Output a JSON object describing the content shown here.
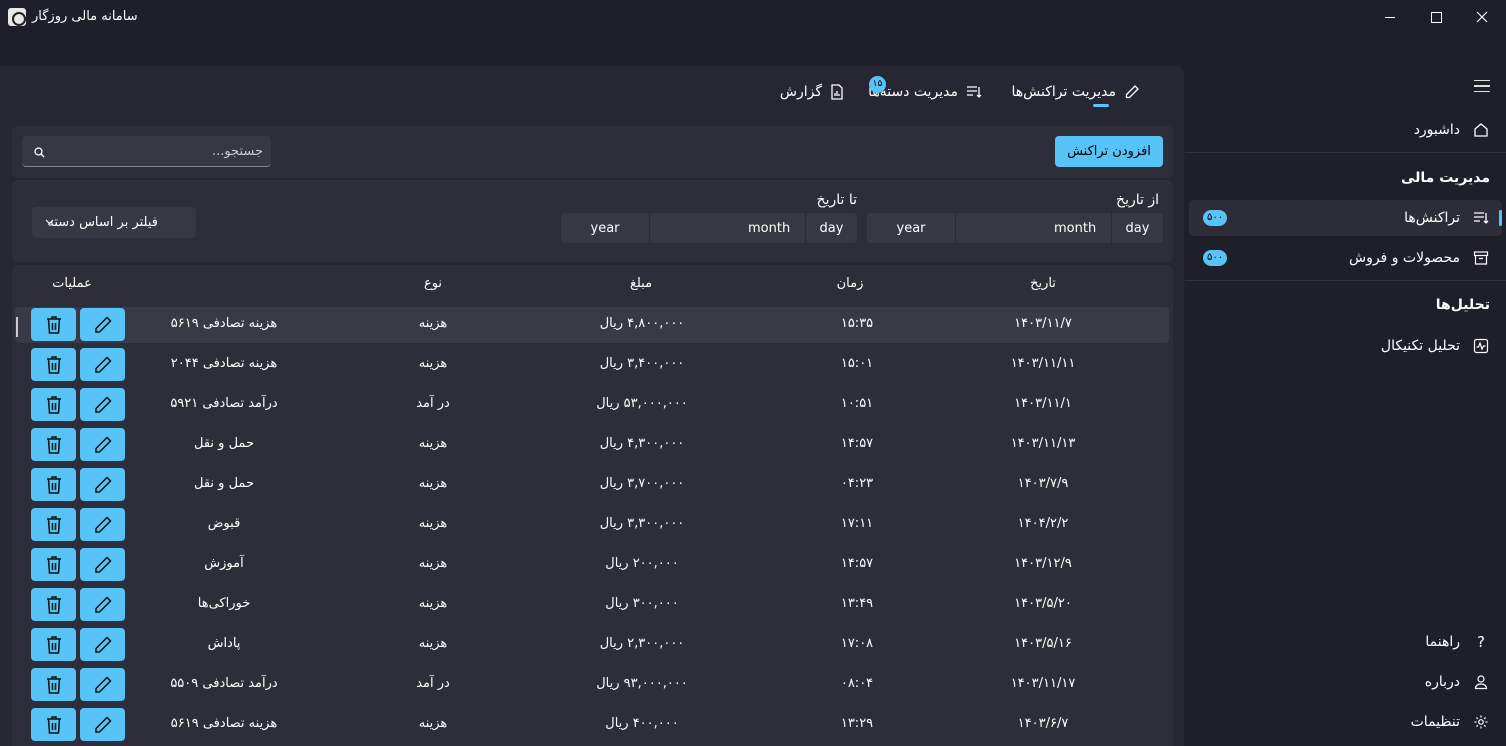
{
  "window": {
    "title": "سامانه مالی روزگار"
  },
  "tabs": [
    {
      "label": "مدیریت تراکنش‌ها",
      "icon": "pencil-icon",
      "selected": true
    },
    {
      "label": "مدیریت دسته‌ها",
      "icon": "list-filter-icon",
      "badge": "۱۵"
    },
    {
      "label": "گزارش",
      "icon": "report-icon"
    }
  ],
  "toolbar": {
    "add_label": "افزودن تراکنش",
    "search_placeholder": "جستجو..."
  },
  "filters": {
    "from_label": "از تاریخ",
    "to_label": "تا تاریخ",
    "day": "day",
    "month": "month",
    "year": "year",
    "category_placeholder": "فیلتر بر اساس دسته"
  },
  "table": {
    "headers": {
      "date": "تاریخ",
      "time": "زمان",
      "amount": "مبلغ",
      "type": "نوع",
      "ops": "عملیات"
    },
    "rows": [
      {
        "date": "۱۴۰۳/۱۱/۷",
        "time": "۱۵:۳۵",
        "amount": "۴,۸۰۰,۰۰۰ ریال",
        "type": "هزینه",
        "desc": "هزینه تصادفی ۵۶۱۹"
      },
      {
        "date": "۱۴۰۳/۱۱/۱۱",
        "time": "۱۵:۰۱",
        "amount": "۳,۴۰۰,۰۰۰ ریال",
        "type": "هزینه",
        "desc": "هزینه تصادفی ۲۰۴۴"
      },
      {
        "date": "۱۴۰۳/۱۱/۱",
        "time": "۱۰:۵۱",
        "amount": "۵۳,۰۰۰,۰۰۰ ریال",
        "type": "در آمد",
        "desc": "درآمد تصادفی ۵۹۲۱"
      },
      {
        "date": "۱۴۰۳/۱۱/۱۳",
        "time": "۱۴:۵۷",
        "amount": "۴,۳۰۰,۰۰۰ ریال",
        "type": "هزینه",
        "desc": "حمل و نقل"
      },
      {
        "date": "۱۴۰۳/۷/۹",
        "time": "۰۴:۲۳",
        "amount": "۳,۷۰۰,۰۰۰ ریال",
        "type": "هزینه",
        "desc": "حمل و نقل"
      },
      {
        "date": "۱۴۰۴/۲/۲",
        "time": "۱۷:۱۱",
        "amount": "۳,۳۰۰,۰۰۰ ریال",
        "type": "هزینه",
        "desc": "قبوض"
      },
      {
        "date": "۱۴۰۳/۱۲/۹",
        "time": "۱۴:۵۷",
        "amount": "۲۰۰,۰۰۰ ریال",
        "type": "هزینه",
        "desc": "آموزش"
      },
      {
        "date": "۱۴۰۳/۵/۲۰",
        "time": "۱۳:۴۹",
        "amount": "۳۰۰,۰۰۰ ریال",
        "type": "هزینه",
        "desc": "خوراکی‌ها"
      },
      {
        "date": "۱۴۰۳/۵/۱۶",
        "time": "۱۷:۰۸",
        "amount": "۲,۳۰۰,۰۰۰ ریال",
        "type": "هزینه",
        "desc": "پاداش"
      },
      {
        "date": "۱۴۰۳/۱۱/۱۷",
        "time": "۰۸:۰۴",
        "amount": "۹۳,۰۰۰,۰۰۰ ریال",
        "type": "در آمد",
        "desc": "درآمد تصادفی ۵۵۰۹"
      },
      {
        "date": "۱۴۰۳/۶/۷",
        "time": "۱۳:۲۹",
        "amount": "۴۰۰,۰۰۰ ریال",
        "type": "هزینه",
        "desc": "هزینه تصادفی ۵۶۱۹"
      }
    ]
  },
  "sidebar": {
    "dashboard": "داشبورد",
    "finance_header": "مدیریت مالی",
    "transactions": {
      "label": "تراکنش‌ها",
      "badge": "۵۰۰"
    },
    "products": {
      "label": "محصولات و فروش",
      "badge": "۵۰۰"
    },
    "analysis_header": "تحلیل‌ها",
    "technical": "تحلیل تکنیکال",
    "help": "راهنما",
    "about": "درباره",
    "settings": "تنظیمات"
  },
  "colors": {
    "accent": "#57c3f6",
    "background": "#1f1f2a",
    "panel": "#272733",
    "card": "#2e2e3a"
  }
}
